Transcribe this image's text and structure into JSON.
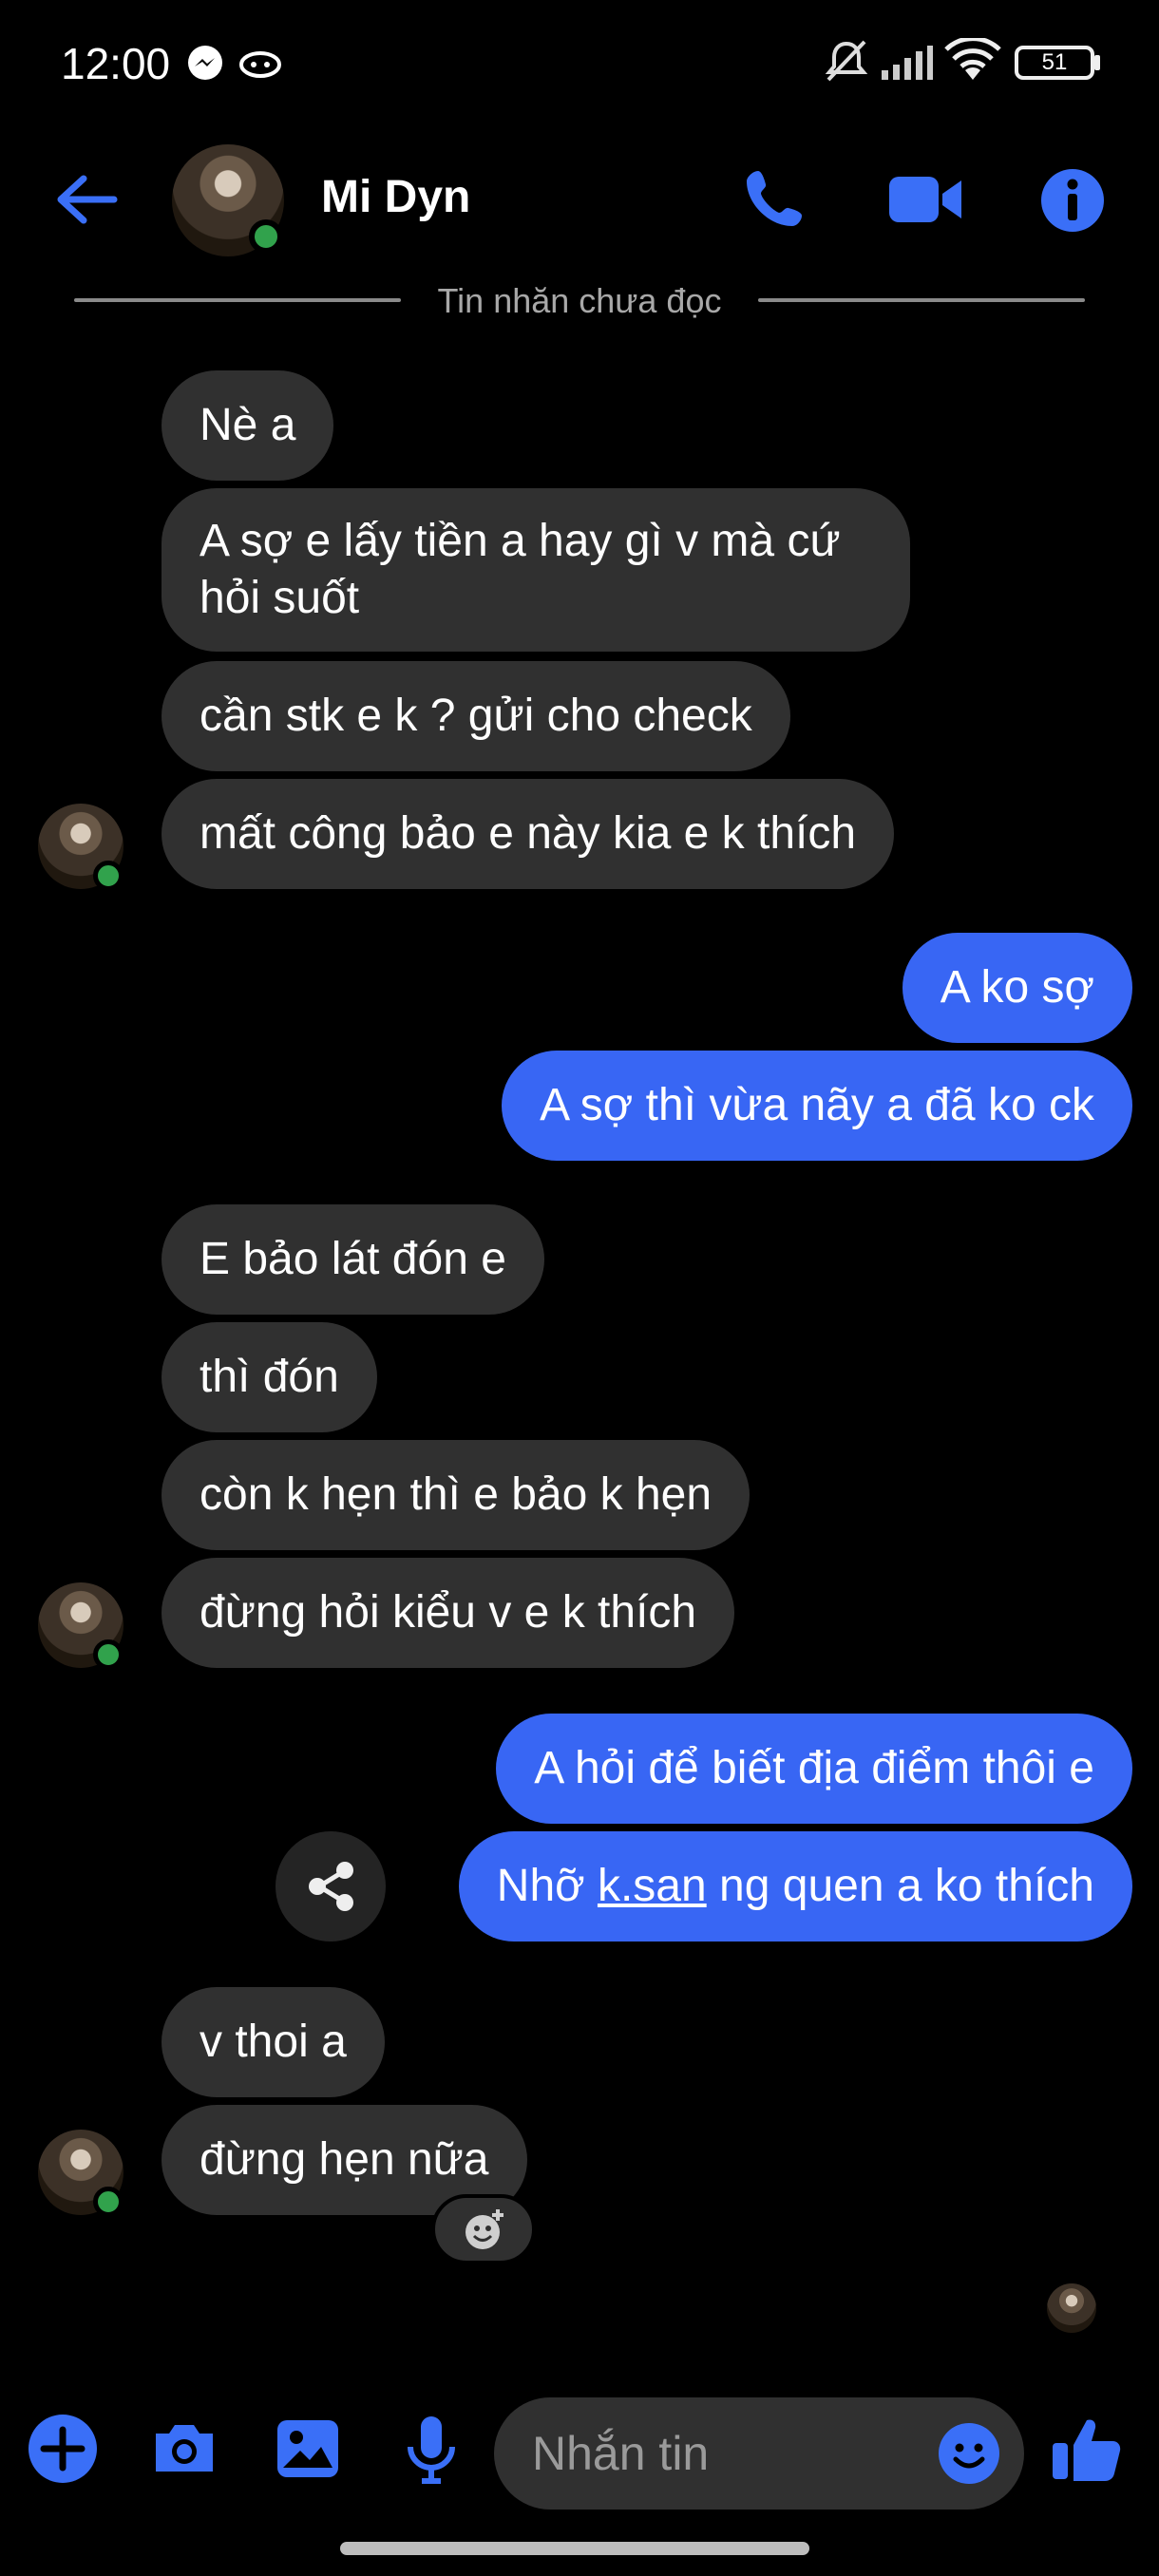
{
  "status_bar": {
    "time": "12:00",
    "battery": "51",
    "icons": [
      "messenger-icon",
      "alien-icon",
      "mute-icon",
      "signal-icon",
      "wifi-icon",
      "battery-icon"
    ]
  },
  "header": {
    "contact_name": "Mi Dyn",
    "unread_divider": "Tin nhăn chưa đọc",
    "icons": [
      "back-arrow-icon",
      "phone-icon",
      "video-icon",
      "info-icon"
    ]
  },
  "messages": [
    {
      "side": "in",
      "text": "Nè a"
    },
    {
      "side": "in",
      "text": "A sợ e lấy tiền a hay gì v mà cứ hỏi suốt"
    },
    {
      "side": "in",
      "text": "cần stk e k ? gửi cho check"
    },
    {
      "side": "in",
      "text": "mất công bảo e này kia e k thích"
    },
    {
      "side": "out",
      "text": "A ko sợ"
    },
    {
      "side": "out",
      "text": "A sợ thì vừa nãy a đã ko ck"
    },
    {
      "side": "in",
      "text": "E bảo lát đón e"
    },
    {
      "side": "in",
      "text": "thì đón"
    },
    {
      "side": "in",
      "text": "còn k hẹn thì e bảo k hẹn"
    },
    {
      "side": "in",
      "text": "đừng hỏi kiểu v e k thích"
    },
    {
      "side": "out",
      "text": "A hỏi để biết địa điểm thôi e"
    },
    {
      "side": "out",
      "text_before": "Nhỡ ",
      "link": "k.san",
      "text_after": " ng quen a ko thích"
    },
    {
      "side": "in",
      "text": "v thoi a"
    },
    {
      "side": "in",
      "text": "đừng hẹn nữa"
    }
  ],
  "composer": {
    "placeholder": "Nhắn tin",
    "icons": [
      "plus-icon",
      "camera-icon",
      "gallery-icon",
      "microphone-icon",
      "emoji-icon",
      "thumbs-up-icon"
    ]
  },
  "colors": {
    "accent": "#3866f4",
    "incoming_bubble": "#303030",
    "online": "#31a24c",
    "background": "#000000"
  }
}
